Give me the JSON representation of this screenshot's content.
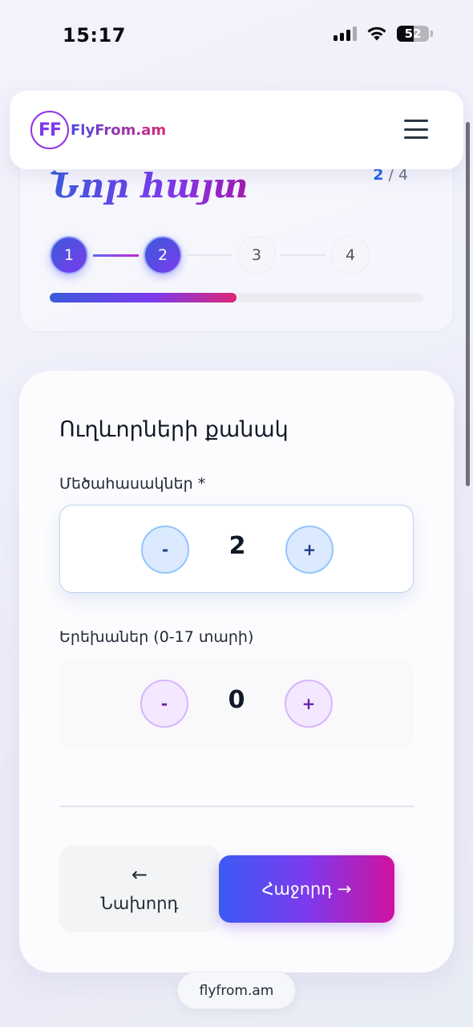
{
  "status_bar": {
    "time": "15:17",
    "battery": "52",
    "battery_level": 0.52,
    "icons": [
      "signal-icon",
      "wifi-icon",
      "battery-icon"
    ]
  },
  "header": {
    "logo_badge": "FF",
    "logo_text": "FlyFrom.am",
    "menu_icon": "hamburger-menu-icon"
  },
  "steps": {
    "title": "Նոր հայտ",
    "current": "2",
    "separator": " / ",
    "total": "4",
    "items": [
      "1",
      "2",
      "3",
      "4"
    ],
    "completed_count": 2,
    "progress": 0.5
  },
  "form": {
    "section_title": "Ուղևորների քանակ",
    "adults": {
      "label": "Մեծահասակներ *",
      "value": "2",
      "minus_label": "-",
      "plus_label": "+"
    },
    "children": {
      "label": "Երեխաներ (0-17 տարի)",
      "value": "0",
      "minus_label": "-",
      "plus_label": "+"
    },
    "prev_arrow": "←",
    "prev_label": "Նախորդ",
    "next_label": "Հաջորդ →"
  },
  "footer": {
    "url": "flyfrom.am"
  },
  "colors": {
    "brand_blue": "#3b5bdb",
    "brand_purple": "#7c3aed",
    "brand_pink": "#db2777",
    "counter_blue": "#93c5fd",
    "counter_purple": "#d8b4fe"
  }
}
